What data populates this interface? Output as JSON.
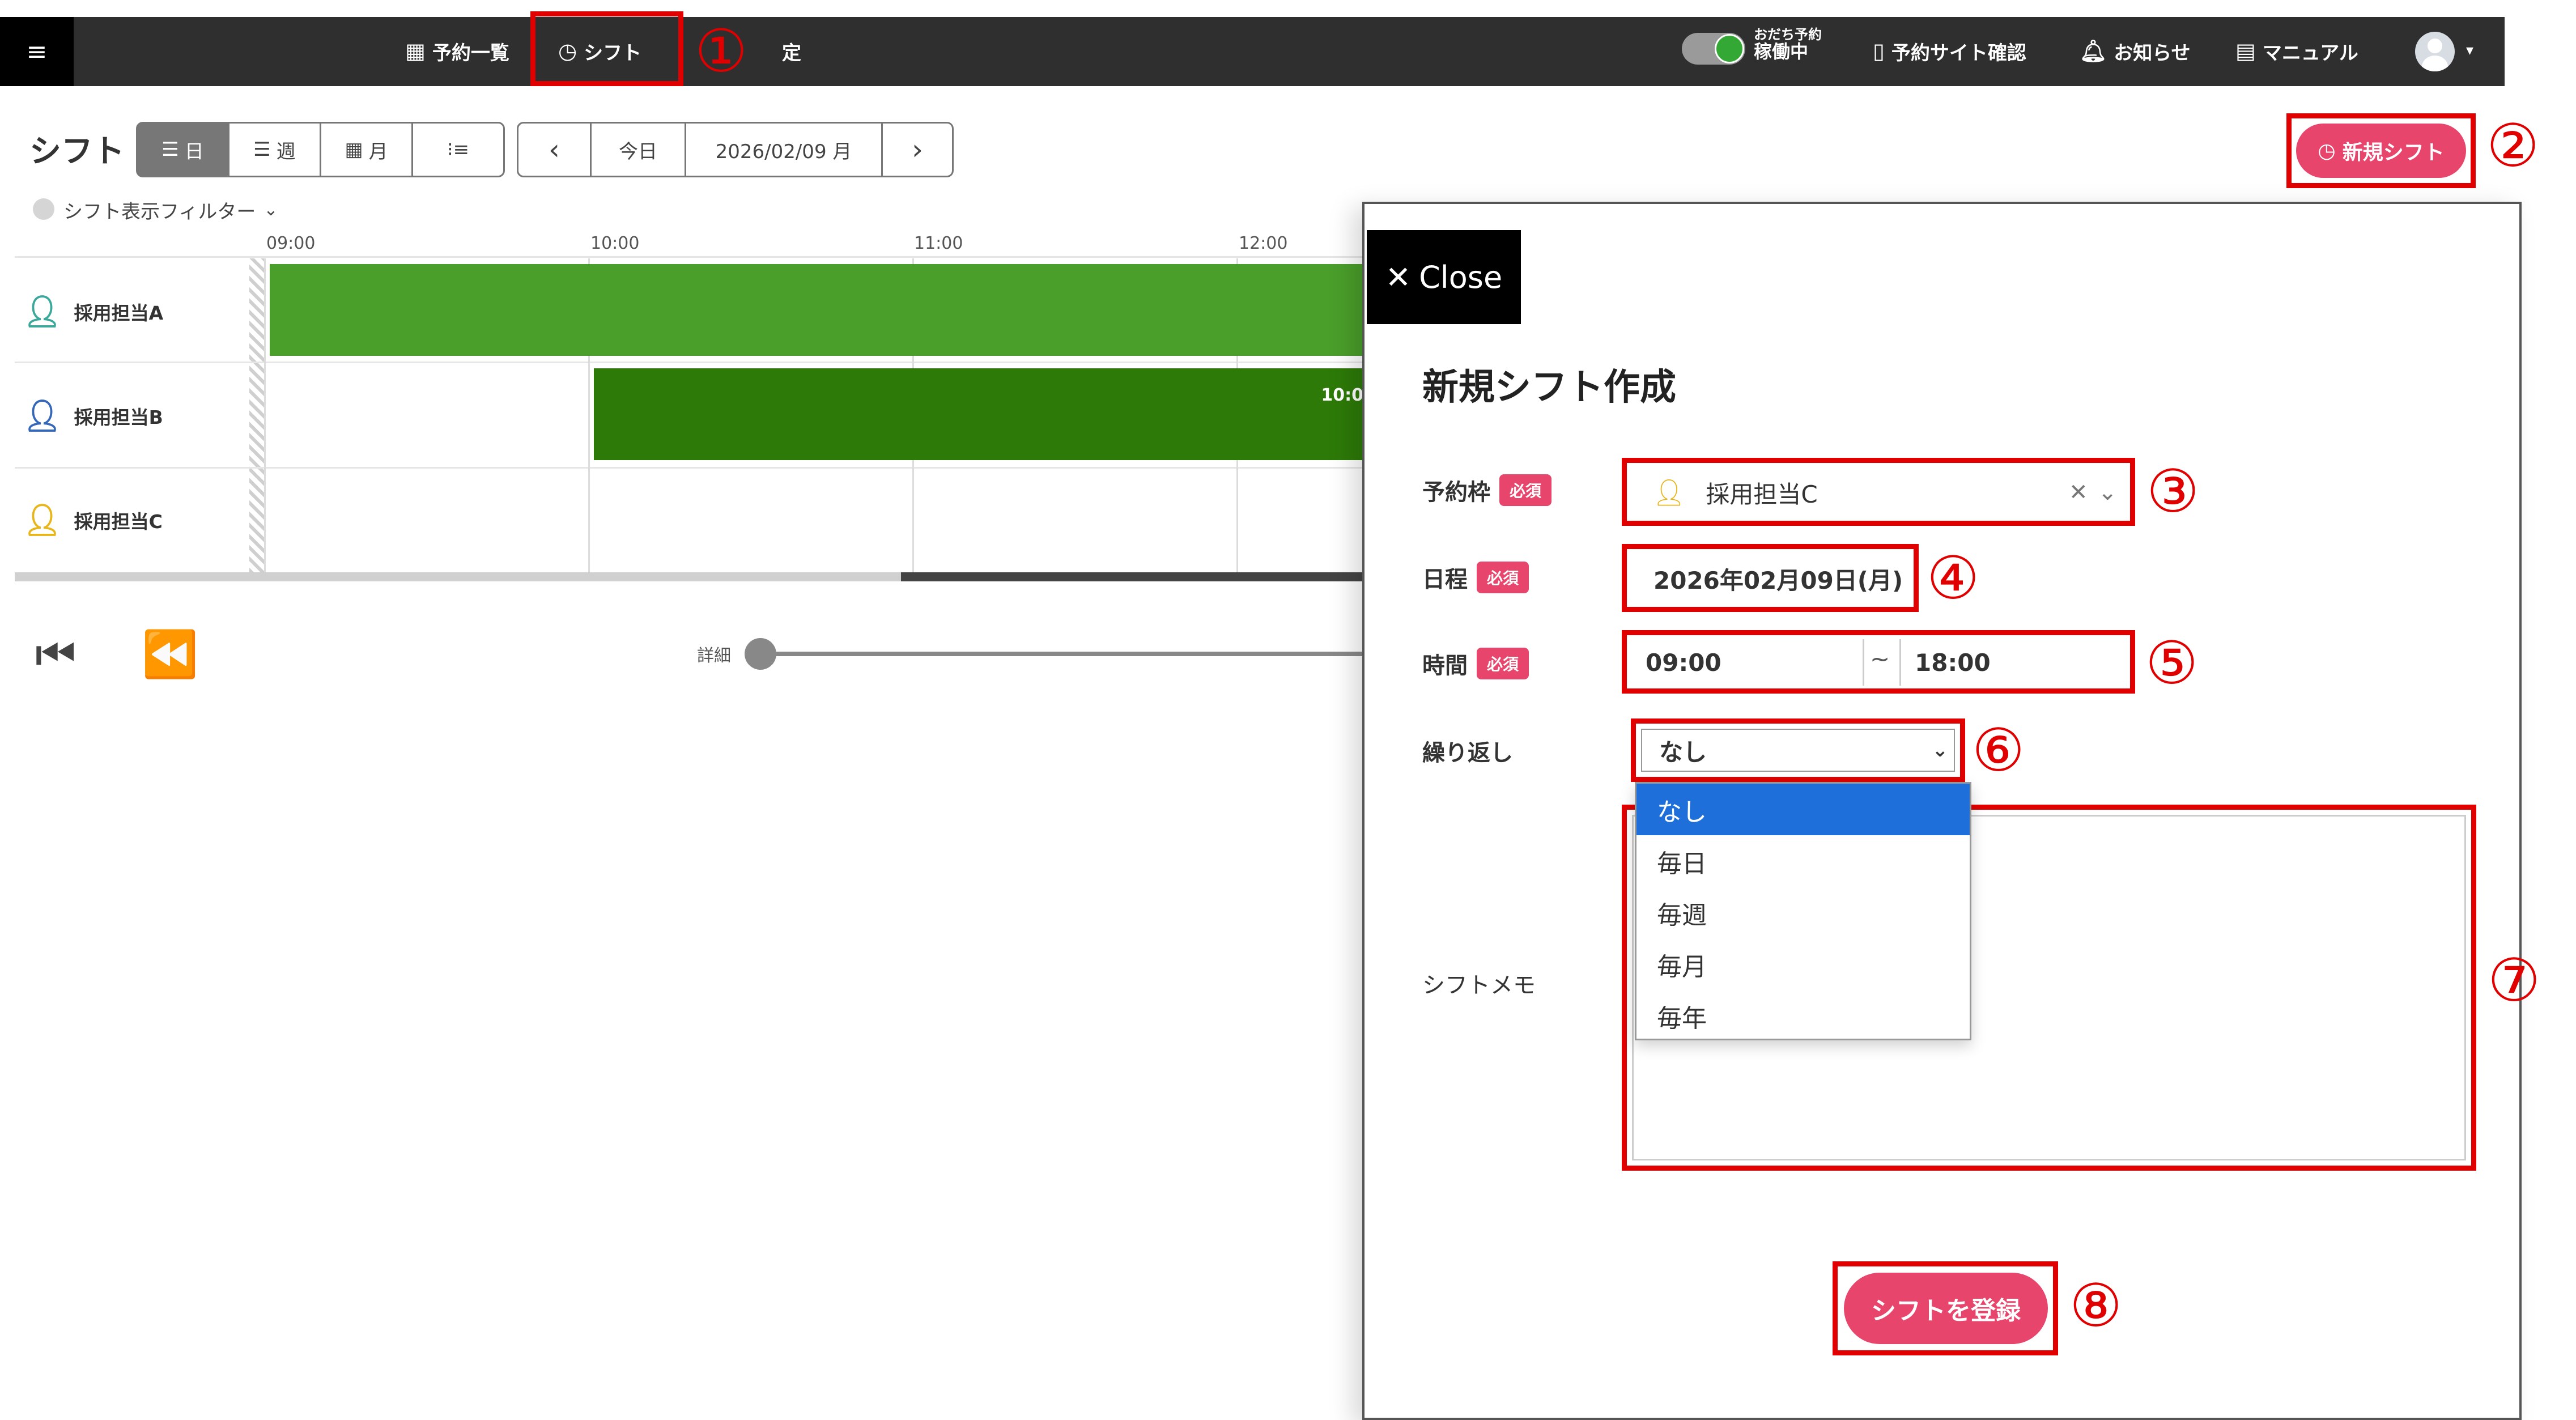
{
  "nav": {
    "menu_icon": "hamburger-icon",
    "booking_list": "予約一覧",
    "shift": "シフト",
    "settings_partial": "定",
    "toggle_top": "おだち予約",
    "toggle_bottom": "稼働中",
    "site_check": "予約サイト確認",
    "notice": "お知らせ",
    "manual": "マニュアル"
  },
  "toolbar": {
    "page_title": "シフト",
    "view_day": "日",
    "view_week": "週",
    "view_month": "月",
    "prev": "‹",
    "today": "今日",
    "date": "2026/02/09 月",
    "next": "›",
    "new_shift": "新規シフト",
    "filter": "シフト表示フィルター"
  },
  "timeline": {
    "hours": [
      "09:00",
      "10:00",
      "11:00",
      "12:00"
    ],
    "rows": [
      {
        "name": "採用担当A",
        "color": "#3aa89a"
      },
      {
        "name": "採用担当B",
        "color": "#3567b8"
      },
      {
        "name": "採用担当C",
        "color": "#e8b61a"
      }
    ],
    "bar_b_label": "10:0",
    "slider_label": "詳細"
  },
  "panel": {
    "close": "Close",
    "title": "新規シフト作成",
    "required": "必須",
    "slot_label": "予約枠",
    "slot_value": "採用担当C",
    "date_label": "日程",
    "date_value": "2026年02月09日(月)",
    "time_label": "時間",
    "time_start": "09:00",
    "time_sep": "~",
    "time_end": "18:00",
    "repeat_label": "繰り返し",
    "repeat_value": "なし",
    "repeat_options": [
      "なし",
      "毎日",
      "毎週",
      "毎月",
      "毎年"
    ],
    "memo_label": "シフトメモ",
    "submit": "シフトを登録"
  },
  "annotations": [
    "①",
    "②",
    "③",
    "④",
    "⑤",
    "⑥",
    "⑦",
    "⑧"
  ],
  "colors": {
    "accent": "#e8456c",
    "bar_a": "#4a9e2a",
    "bar_b": "#2d7a08",
    "highlight": "#e00000",
    "dropdown_selected": "#1e6fd9"
  }
}
